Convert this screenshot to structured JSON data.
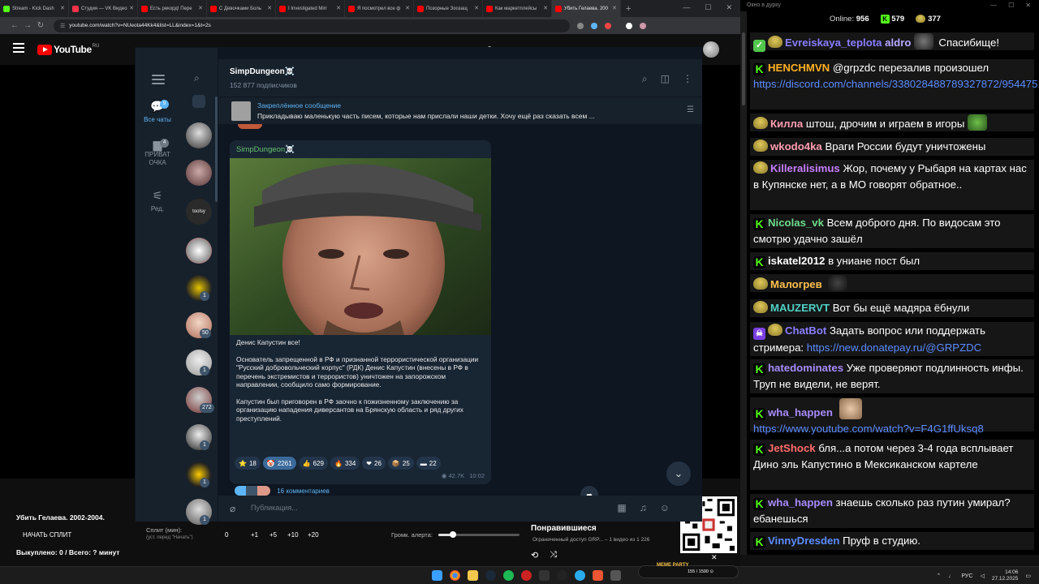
{
  "browser": {
    "tabs": [
      {
        "label": "Stream - Kick Dash",
        "color": "#53fc18"
      },
      {
        "label": "Студия — VK Видео",
        "color": "#ff3347"
      },
      {
        "label": "Есть рекорд! Пере",
        "color": "#ff0000"
      },
      {
        "label": "С Девочками Боль",
        "color": "#ff0000"
      },
      {
        "label": "I Investigated Mirr",
        "color": "#ff0000"
      },
      {
        "label": "Я посмотрел все ф",
        "color": "#ff0000"
      },
      {
        "label": "Позорные Зоозащ",
        "color": "#ff0000"
      },
      {
        "label": "Как маркетплейсы",
        "color": "#ff0000"
      },
      {
        "label": "Убить Гелаева. 200",
        "color": "#ff0000",
        "active": true
      }
    ],
    "url": "youtube.com/watch?v=NUeota44Kk4&list=LL&index=1&t=2s"
  },
  "youtube": {
    "logo": "YouTube",
    "region": "RU",
    "video_title": "Убить Гелаева. 2002-2004.",
    "split": {
      "button": "НАЧАТЬ СПЛИТ",
      "label": "Сплит (мин):",
      "sublabel": "(уст. перед \"Начать\")",
      "values": [
        "0",
        "+1",
        "+5",
        "+10",
        "+20"
      ],
      "alert_label": "Громк. алерта:",
      "alert_level": 0.18
    },
    "spent": "Выкуплено: 0 / Всего: ? минут",
    "liked_title": "Понравившиеся",
    "liked_sub": "Ограниченный доступ GRP... – 1 видео из 1 226"
  },
  "telegram": {
    "folders": [
      {
        "label": "Все чаты",
        "badge": "9"
      },
      {
        "label": "ПРИВАТ ОЧКА",
        "badge": "4"
      },
      {
        "label": "Ред."
      }
    ],
    "chat_badges": [
      "1",
      "50",
      "1",
      "272",
      "1",
      "1",
      "1"
    ],
    "chat_text_avatar": "toolsy",
    "channel": {
      "name": "SimpDungeon☠️",
      "subscribers": "152 877 подписчиков"
    },
    "pinned": {
      "title": "Закреплённое сообщение",
      "text": "Прикладываю маленькую часть писем, которые нам прислали наши детки.   Хочу ещё раз сказать всем ..."
    },
    "post": {
      "author": "SimpDungeon☠️",
      "text": "Денис Капустин все!\n\nОснователь запрещенной в РФ и признанной террористической организации \"Русский добровольческий корпус\" (РДК) Денис Капустин (внесены в РФ в перечень экстремистов и террористов) уничтожен на запорожском направлении, сообщило само формирование.\n\nКапустин был приговорен в РФ заочно к пожизненному заключению за организацию нападения диверсантов на Брянскую область и ряд других преступлений.",
      "reactions": [
        {
          "emoji": "⭐",
          "count": "18"
        },
        {
          "emoji": "🤡",
          "count": "2261",
          "me": true
        },
        {
          "emoji": "👍",
          "count": "629"
        },
        {
          "emoji": "🔥",
          "count": "334"
        },
        {
          "emoji": "❤",
          "count": "26"
        },
        {
          "emoji": "📦",
          "count": "25"
        },
        {
          "emoji": "▬",
          "count": "22"
        }
      ],
      "views": "42.7K",
      "time": "10:02",
      "comments": "16 комментариев"
    },
    "compose_placeholder": "Публикация..."
  },
  "chat": {
    "window_title": "Окно в дурку",
    "online_label": "Online:",
    "online": "956",
    "kick_count": "579",
    "other_count": "377",
    "messages": [
      {
        "badges": [
          "check",
          "pepe"
        ],
        "nick": "Evreiskaya_teplota",
        "color": "#8a7dff",
        "text": "aldro",
        "text2": "Спасибище!"
      },
      {
        "badges": [
          "k"
        ],
        "nick": "HENCHMVN",
        "color": "#ffb020",
        "text": "@grpzdc перезалив произошел",
        "link": "https://discord.com/channels/338028488789327872/954475130808..."
      },
      {
        "badges": [
          "pepe"
        ],
        "nick": "Килла",
        "color": "#ff9db1",
        "text": "штош, дрочим и играем в игоры"
      },
      {
        "badges": [
          "pepe"
        ],
        "nick": "wkodo4ka",
        "color": "#ff9db1",
        "text": "Враги России будут уничтожены"
      },
      {
        "badges": [
          "pepe"
        ],
        "nick": "Killeralisimus",
        "color": "#c77dff",
        "text": "Жор, почему у Рыбаря на картах нас в Купянске нет, а в МО говорят обратное.."
      },
      {
        "badges": [
          "k"
        ],
        "nick": "Nicolas_vk",
        "color": "#6fdc8c",
        "text": "Всем доброго дня. По видосам это смотрю удачно зашёл"
      },
      {
        "badges": [
          "k"
        ],
        "nick": "iskatel2012",
        "color": "#ffffff",
        "text": "в униане пост был"
      },
      {
        "badges": [
          "pepe"
        ],
        "nick": "Малогрев",
        "color": "#ffc04d",
        "text": ""
      },
      {
        "badges": [
          "pepe"
        ],
        "nick": "MAUZERVT",
        "color": "#4fd1c5",
        "text": "Вот бы ещё мадяра ёбнули"
      },
      {
        "badges": [
          "bot",
          "pepe"
        ],
        "nick": "ChatBot",
        "color": "#8a7dff",
        "text": "Задать вопрос или поддержать стримера:",
        "link": "https://new.donatepay.ru/@GRPZDC"
      },
      {
        "badges": [
          "k"
        ],
        "nick": "hatedominates",
        "color": "#a78bfa",
        "text": "Уже проверяют подлинность инфы. Труп не видели, не верят."
      },
      {
        "badges": [
          "k"
        ],
        "nick": "wha_happen",
        "color": "#a78bfa",
        "text": "",
        "link": "https://www.youtube.com/watch?v=F4G1ffUksq8"
      },
      {
        "badges": [
          "k"
        ],
        "nick": "JetShock",
        "color": "#ff6b6b",
        "text": "бля...а потом через 3-4 года всплывает Дино эль Капустино в Мексиканском картеле"
      },
      {
        "badges": [
          "k"
        ],
        "nick": "wha_happen",
        "color": "#a78bfa",
        "text": "знаешь сколько раз путин умирал? ебанешься"
      },
      {
        "badges": [
          "k"
        ],
        "nick": "VinnyDresden",
        "color": "#5b8cff",
        "text": "Пруф в студию."
      }
    ]
  },
  "taskbar": {
    "lang": "РУС",
    "time": "14:06",
    "date": "27.12.2025",
    "widget_brand": "MEME PARTY",
    "widget_text": "155 / 1590 ⊙"
  }
}
